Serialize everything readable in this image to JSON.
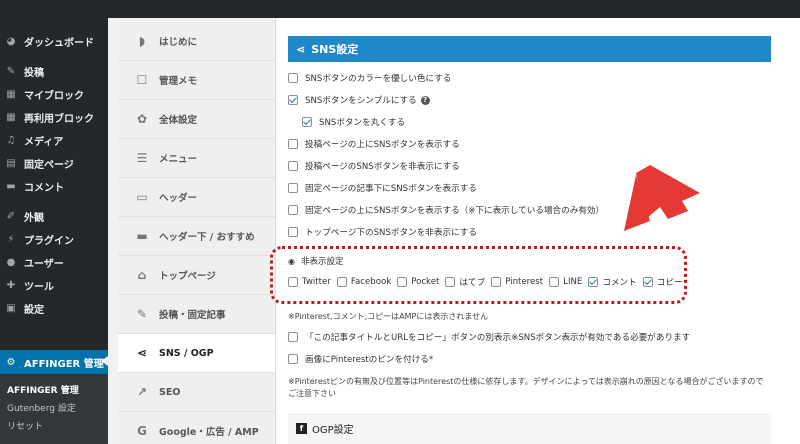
{
  "wp_sidebar": {
    "items": [
      {
        "label": "ダッシュボード",
        "icon": "dashboard-icon"
      },
      {
        "label": "投稿",
        "icon": "pin-icon"
      },
      {
        "label": "マイブロック",
        "icon": "blocks-icon"
      },
      {
        "label": "再利用ブロック",
        "icon": "blocks-icon"
      },
      {
        "label": "メディア",
        "icon": "media-icon"
      },
      {
        "label": "固定ページ",
        "icon": "page-icon"
      },
      {
        "label": "コメント",
        "icon": "comment-icon"
      },
      {
        "label": "外観",
        "icon": "brush-icon"
      },
      {
        "label": "プラグイン",
        "icon": "plugin-icon"
      },
      {
        "label": "ユーザー",
        "icon": "user-icon"
      },
      {
        "label": "ツール",
        "icon": "wrench-icon"
      },
      {
        "label": "設定",
        "icon": "settings-icon"
      }
    ],
    "active_item": {
      "label": "AFFINGER 管理",
      "icon": "gear-icon"
    },
    "submenu": [
      "AFFINGER 管理",
      "Gutenberg 設定",
      "リセット"
    ]
  },
  "aff_tabs": [
    {
      "label": "はじめに",
      "icon": "beginner-icon"
    },
    {
      "label": "管理メモ",
      "icon": "memo-icon"
    },
    {
      "label": "全体設定",
      "icon": "palette-icon"
    },
    {
      "label": "メニュー",
      "icon": "menu-icon"
    },
    {
      "label": "ヘッダー",
      "icon": "header-icon"
    },
    {
      "label": "ヘッダー下 / おすすめ",
      "icon": "header-below-icon"
    },
    {
      "label": "トップページ",
      "icon": "home-icon"
    },
    {
      "label": "投稿・固定記事",
      "icon": "edit-icon"
    },
    {
      "label": "SNS / OGP",
      "icon": "share-icon"
    },
    {
      "label": "SEO",
      "icon": "chart-icon"
    },
    {
      "label": "Google・広告 / AMP",
      "icon": "google-icon"
    }
  ],
  "content": {
    "section_title": "SNS設定",
    "options": [
      {
        "label": "SNSボタンのカラーを優しい色にする",
        "checked": false
      },
      {
        "label": "SNSボタンをシンプルにする",
        "checked": true
      },
      {
        "label": "SNSボタンを丸くする",
        "checked": true
      },
      {
        "label": "投稿ページの上にSNSボタンを表示する",
        "checked": false
      },
      {
        "label": "投稿ページのSNSボタンを非表示にする",
        "checked": false
      },
      {
        "label": "固定ページの記事下にSNSボタンを表示する",
        "checked": false
      },
      {
        "label": "固定ページの上にSNSボタンを表示する（※下に表示している場合のみ有効）",
        "checked": false
      },
      {
        "label": "トップページ下のSNSボタンを非表示にする",
        "checked": false
      }
    ],
    "hide_heading": "非表示設定",
    "hide_options": [
      {
        "label": "Twitter",
        "checked": false
      },
      {
        "label": "Facebook",
        "checked": false
      },
      {
        "label": "Pocket",
        "checked": false
      },
      {
        "label": "はてブ",
        "checked": false
      },
      {
        "label": "Pinterest",
        "checked": false
      },
      {
        "label": "LINE",
        "checked": true
      },
      {
        "label": "コメント",
        "checked": true
      },
      {
        "label": "コピー",
        "checked": false
      }
    ],
    "note_pinterest": "※Pinterest,コメント,コピーはAMPには表示されません",
    "copy_option": "「この記事タイトルとURLをコピー」ボタンの別表示※SNSボタン表示が有効である必要があります",
    "pin_option": "画像にPinterestのピンを付ける*",
    "note_long": "※Pinterestピンの有無及び位置等はPinterestの仕様に依存します。デザインによっては表示崩れの原因となる場合がございますので",
    "note_long2": "ご注意下さい",
    "ogp_title": "OGP設定"
  }
}
